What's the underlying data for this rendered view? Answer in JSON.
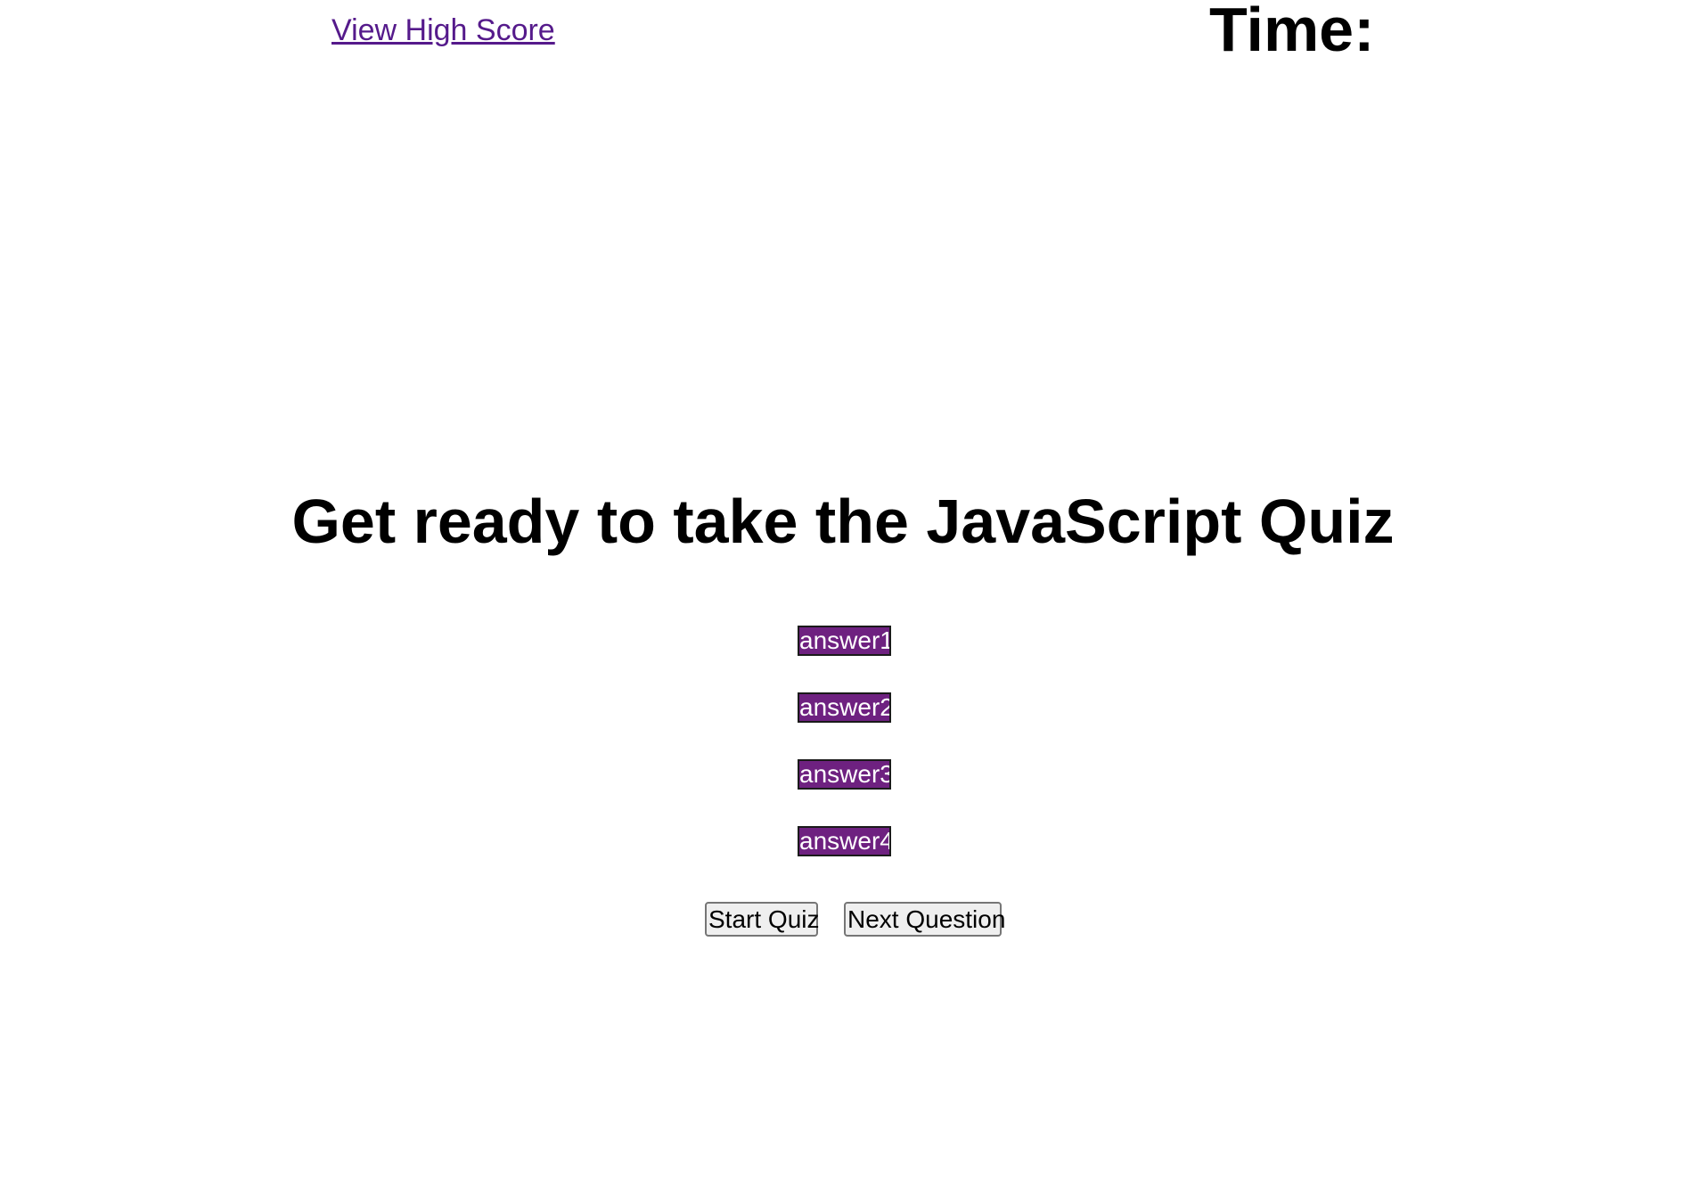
{
  "header": {
    "high_score_link": "View High Score",
    "timer_label": "Time:"
  },
  "quiz": {
    "title": "Get ready to take the JavaScript Quiz",
    "answers": [
      "answer1",
      "answer2",
      "answer3",
      "answer4"
    ]
  },
  "controls": {
    "start_label": "Start Quiz",
    "next_label": "Next Question"
  },
  "colors": {
    "link": "#551a8b",
    "answer_background": "#6e2180",
    "answer_text": "#ffffff",
    "button_background": "#efefef"
  }
}
